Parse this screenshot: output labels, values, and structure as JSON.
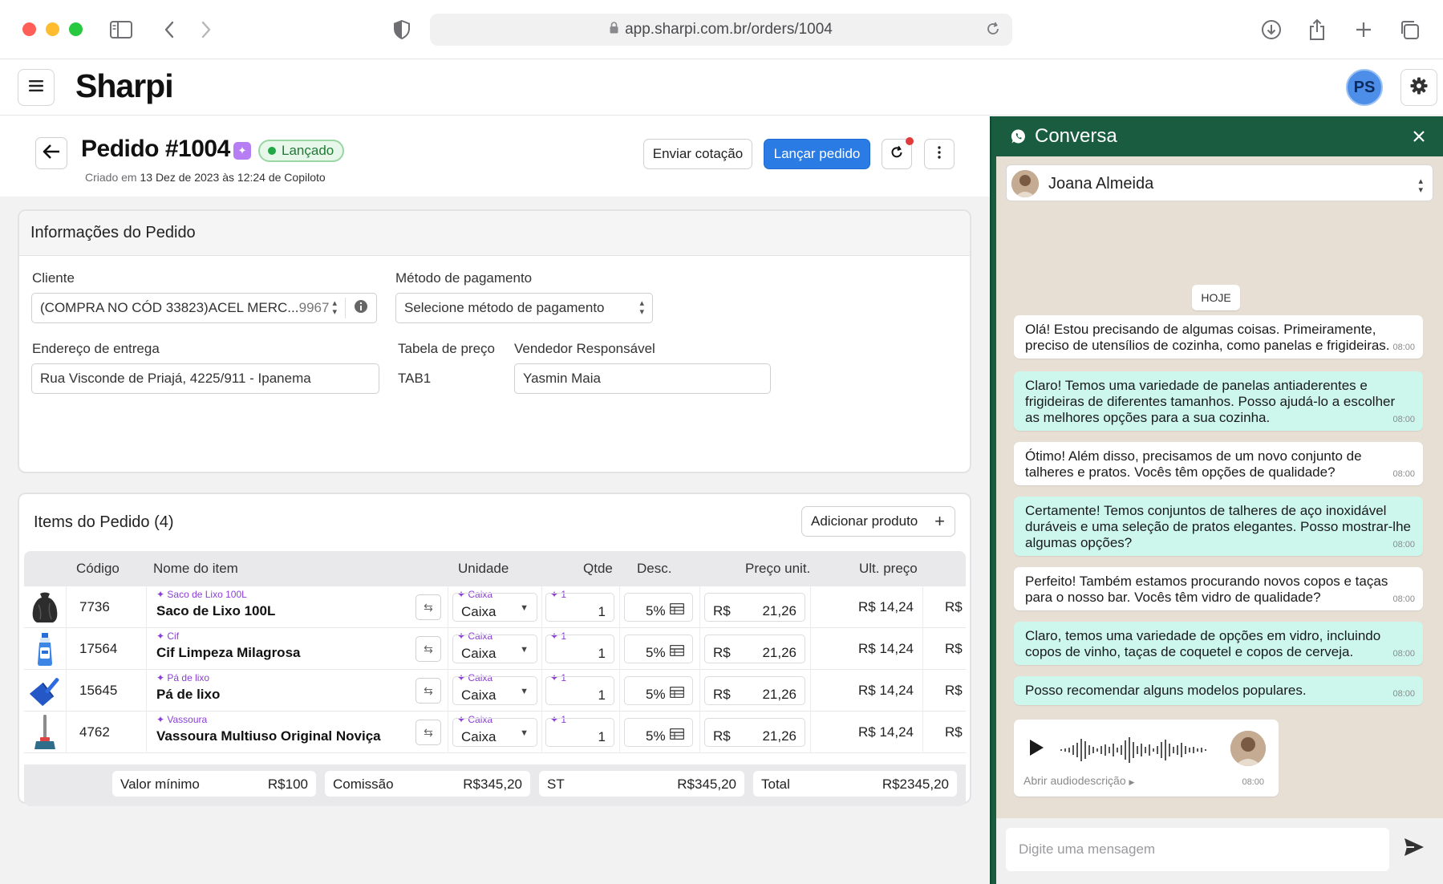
{
  "browser": {
    "url": "app.sharpi.com.br/orders/1004"
  },
  "app": {
    "brand": "Sharpi",
    "user_initials": "PS"
  },
  "order": {
    "title": "Pedido #1004",
    "status": "Lançado",
    "created_prefix": "Criado em",
    "created_date": "13 Dez de 2023 às 12:24",
    "created_suffix": "de Copiloto",
    "actions": {
      "send_quote": "Enviar cotação",
      "launch_order": "Lançar pedido"
    }
  },
  "info": {
    "heading": "Informações do Pedido",
    "client_label": "Cliente",
    "client_value": "(COMPRA NO CÓD 33823)ACEL MERC...",
    "client_code": "9967",
    "payment_label": "Método de pagamento",
    "payment_placeholder": "Selecione método de pagamento",
    "address_label": "Endereço de entrega",
    "address_value": "Rua Visconde de Priajá, 4225/911 - Ipanema",
    "price_table_label": "Tabela de preço",
    "price_table_value": "TAB1",
    "seller_label": "Vendedor Responsável",
    "seller_value": "Yasmin Maia"
  },
  "items": {
    "heading": "Items do Pedido (4)",
    "add_product": "Adicionar produto",
    "columns": [
      "Código",
      "Nome do item",
      "Unidade",
      "Qtde",
      "Desc.",
      "Preço unit.",
      "Ult. preço"
    ],
    "rows": [
      {
        "code": "7736",
        "tag": "✦ Saco de Lixo 100L",
        "name": "Saco de Lixo 100L",
        "unit_tag": "✦ Caixa",
        "unit": "Caixa",
        "qty_tag": "✦ 1",
        "qty": "1",
        "discount": "5%",
        "currency": "R$",
        "price": "21,26",
        "last_price": "R$ 14,24",
        "trailing": "R$",
        "icon": "trash-bag-icon"
      },
      {
        "code": "17564",
        "tag": "✦ Cif",
        "name": "Cif Limpeza Milagrosa",
        "unit_tag": "✦ Caixa",
        "unit": "Caixa",
        "qty_tag": "✦ 1",
        "qty": "1",
        "discount": "5%",
        "currency": "R$",
        "price": "21,26",
        "last_price": "R$ 14,24",
        "trailing": "R$",
        "icon": "spray-bottle-icon"
      },
      {
        "code": "15645",
        "tag": "✦ Pá de lixo",
        "name": "Pá de lixo",
        "unit_tag": "✦ Caixa",
        "unit": "Caixa",
        "qty_tag": "✦ 1",
        "qty": "1",
        "discount": "5%",
        "currency": "R$",
        "price": "21,26",
        "last_price": "R$ 14,24",
        "trailing": "R$",
        "icon": "dustpan-icon"
      },
      {
        "code": "4762",
        "tag": "✦ Vassoura",
        "name": "Vassoura Multiuso Original Noviça",
        "unit_tag": "✦ Caixa",
        "unit": "Caixa",
        "qty_tag": "✦ 1",
        "qty": "1",
        "discount": "5%",
        "currency": "R$",
        "price": "21,26",
        "last_price": "R$ 14,24",
        "trailing": "R$",
        "icon": "broom-icon"
      }
    ],
    "totals": {
      "min_label": "Valor mínimo",
      "min_value": "R$100",
      "commission_label": "Comissão",
      "commission_value": "R$345,20",
      "st_label": "ST",
      "st_value": "R$345,20",
      "total_label": "Total",
      "total_value": "R$2345,20"
    }
  },
  "chat": {
    "title": "Conversa",
    "contact": "Joana Almeida",
    "day": "HOJE",
    "messages": [
      {
        "dir": "in",
        "text": "Olá! Estou precisando de algumas coisas. Primeiramente, preciso de utensílios de cozinha, como panelas e frigideiras.",
        "time": "08:00"
      },
      {
        "dir": "out",
        "text": "Claro! Temos uma variedade de panelas antiaderentes e frigideiras de diferentes tamanhos. Posso ajudá-lo a escolher as melhores opções para a sua cozinha.",
        "time": "08:00"
      },
      {
        "dir": "in",
        "text": "Ótimo! Além disso, precisamos de um novo conjunto de talheres e pratos. Vocês têm opções de qualidade?",
        "time": "08:00"
      },
      {
        "dir": "out",
        "text": "Certamente! Temos conjuntos de talheres de aço inoxidável duráveis e uma seleção de pratos elegantes. Posso mostrar-lhe algumas opções?",
        "time": "08:00"
      },
      {
        "dir": "in",
        "text": "Perfeito! Também estamos procurando novos copos e taças para o nosso bar. Vocês têm vidro de qualidade?",
        "time": "08:00"
      },
      {
        "dir": "out",
        "text": "Claro, temos uma variedade de opções em vidro, incluindo copos de vinho, taças de coquetel e copos de cerveja.",
        "time": "08:00"
      },
      {
        "dir": "out",
        "text": "Posso recomendar alguns modelos populares.",
        "time": "08:00"
      }
    ],
    "audio": {
      "desc": "Abrir audiodescrição",
      "time": "08:00"
    },
    "input_placeholder": "Digite uma mensagem"
  }
}
